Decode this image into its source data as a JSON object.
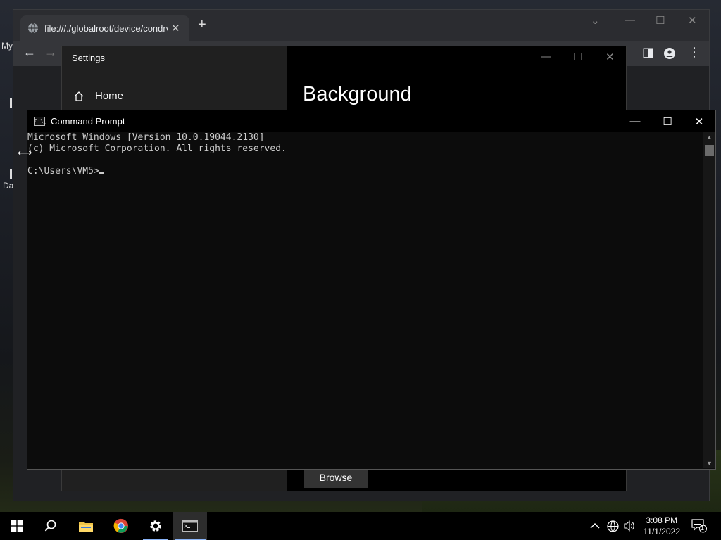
{
  "desktop": {
    "icon_labels": [
      "My",
      "Da"
    ]
  },
  "browser": {
    "tab_title": "file:///./globalroot/device/condrv/",
    "new_tab_symbol": "+",
    "close_tab_symbol": "✕"
  },
  "settings": {
    "window_title": "Settings",
    "home_label": "Home",
    "page_title": "Background",
    "browse_button": "Browse"
  },
  "cmd": {
    "window_title": "Command Prompt",
    "icon_text": "C:\\_",
    "lines": [
      "Microsoft Windows [Version 10.0.19044.2130]",
      "(c) Microsoft Corporation. All rights reserved.",
      "",
      "C:\\Users\\VM5>"
    ]
  },
  "taskbar": {
    "time": "3:08 PM",
    "date": "11/1/2022",
    "notification_count": "1",
    "icons": [
      "start-icon",
      "search-icon",
      "file-explorer-icon",
      "chrome-icon",
      "settings-icon",
      "command-prompt-icon"
    ]
  }
}
